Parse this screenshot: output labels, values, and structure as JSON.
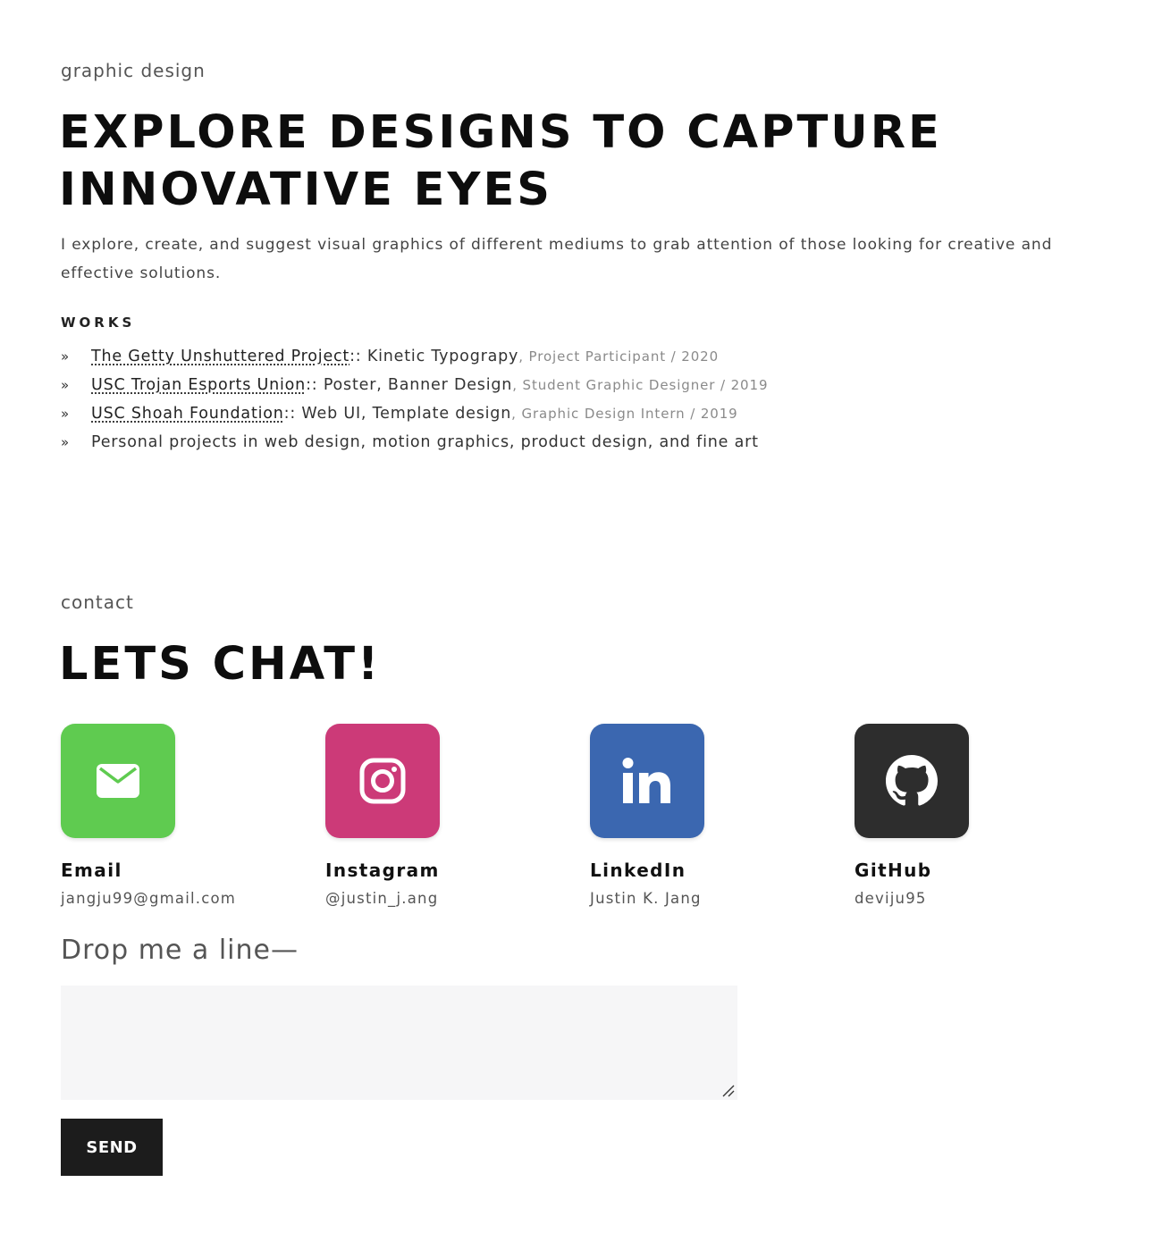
{
  "design": {
    "kicker": "graphic design",
    "heading_line1": "EXPLORE DESIGNS TO CAPTURE",
    "heading_line2": "INNOVATIVE EYES",
    "intro": "I explore, create, and suggest visual graphics of different mediums to grab attention of those looking for creative and effective solutions.",
    "works_title": "WORKS",
    "works": [
      {
        "bullet": "»",
        "link": "The Getty Unshuttered Project",
        "desc": ":: Kinetic Typograpy",
        "role": ", Project Participant / 2020"
      },
      {
        "bullet": "»",
        "link": "USC Trojan Esports Union",
        "desc": ":: Poster, Banner Design",
        "role": ", Student Graphic Designer / 2019"
      },
      {
        "bullet": "»",
        "link": "USC Shoah Foundation",
        "desc": ":: Web UI, Template design",
        "role": ", Graphic Design Intern / 2019"
      },
      {
        "bullet": "»",
        "text": "Personal projects in web design, motion graphics, product design, and fine art"
      }
    ]
  },
  "contact": {
    "kicker": "contact",
    "heading": "LETS CHAT!",
    "items": [
      {
        "label": "Email",
        "value": "jangju99@gmail.com",
        "icon": "mail-icon",
        "color": "#5fcb50"
      },
      {
        "label": "Instagram",
        "value": "@justin_j.ang",
        "icon": "instagram-icon",
        "color": "#cc3a78"
      },
      {
        "label": "LinkedIn",
        "value": "Justin K. Jang",
        "icon": "linkedin-icon",
        "color": "#3b67b0"
      },
      {
        "label": "GitHub",
        "value": "deviju95",
        "icon": "github-icon",
        "color": "#2d2d2d"
      }
    ],
    "drop_line": "Drop me a line—",
    "message_placeholder": "",
    "send_label": "SEND"
  }
}
